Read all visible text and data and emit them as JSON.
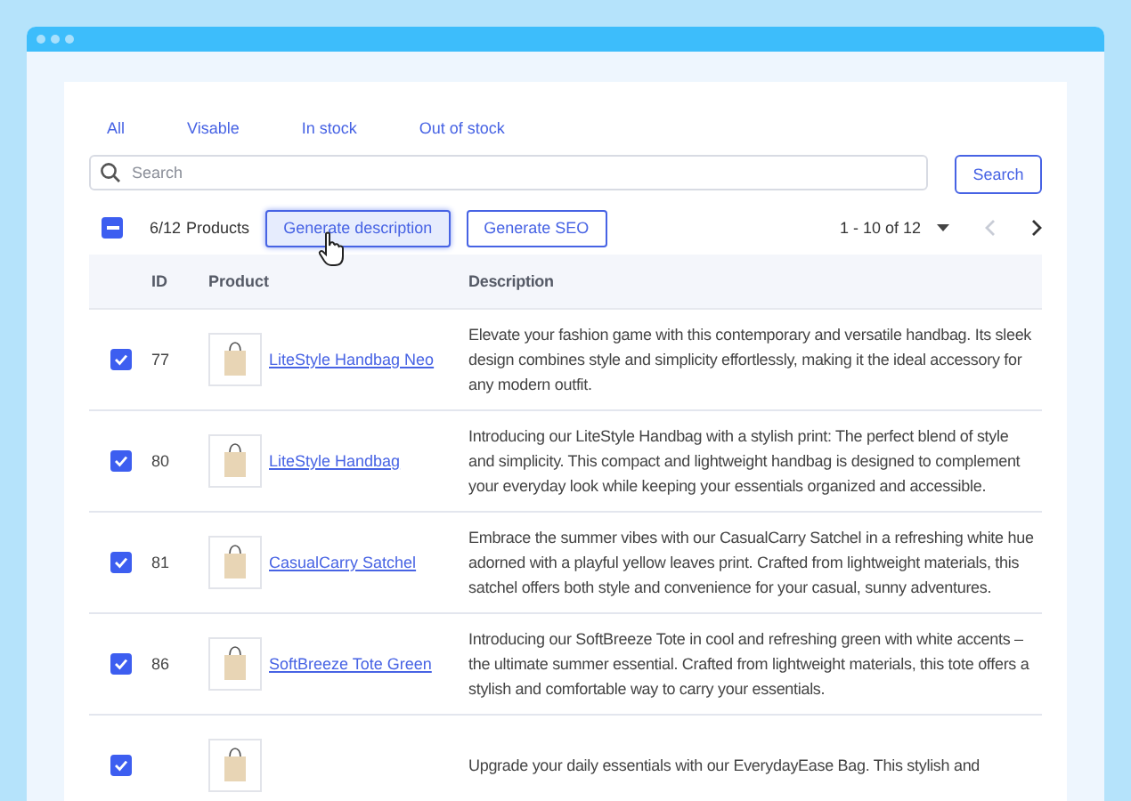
{
  "tabs": [
    {
      "label": "All"
    },
    {
      "label": "Visable"
    },
    {
      "label": "In stock"
    },
    {
      "label": "Out of stock"
    }
  ],
  "search": {
    "placeholder": "Search",
    "button": "Search"
  },
  "toolbar": {
    "select_all_indeterminate": true,
    "count": "6/12",
    "count_label": "Products",
    "buttons": [
      {
        "label": "Generate description",
        "focused": true
      },
      {
        "label": "Generate SEO",
        "focused": false
      }
    ],
    "range": "1 - 10 of 12",
    "prev_disabled": true,
    "next_disabled": false
  },
  "table": {
    "columns": [
      "ID",
      "Product",
      "Description"
    ],
    "rows": [
      {
        "checked": true,
        "id": "77",
        "product": "LiteStyle Handbag Neo",
        "description": "Elevate your fashion game with this contemporary and versatile handbag. Its sleek design combines style and simplicity effortlessly, making it the ideal accessory for any modern outfit."
      },
      {
        "checked": true,
        "id": "80",
        "product": "LiteStyle Handbag",
        "description": "Introducing our LiteStyle Handbag with a stylish print: The perfect blend of style and simplicity. This compact and lightweight handbag is designed to complement your everyday look while keeping your essentials organized and accessible."
      },
      {
        "checked": true,
        "id": "81",
        "product": "CasualCarry Satchel",
        "description": "Embrace the summer vibes with our CasualCarry Satchel in a refreshing white hue adorned with a playful yellow leaves print. Crafted from lightweight materials, this satchel offers both style and convenience for your casual, sunny adventures."
      },
      {
        "checked": true,
        "id": "86",
        "product": "SoftBreeze Tote Green",
        "description": "Introducing our SoftBreeze Tote in cool and refreshing green with white accents – the ultimate summer essential. Crafted from lightweight materials, this tote offers a stylish and comfortable way to carry your essentials."
      },
      {
        "checked": true,
        "description": "Upgrade your daily essentials with our EverydayEase Bag. This stylish and"
      }
    ]
  }
}
